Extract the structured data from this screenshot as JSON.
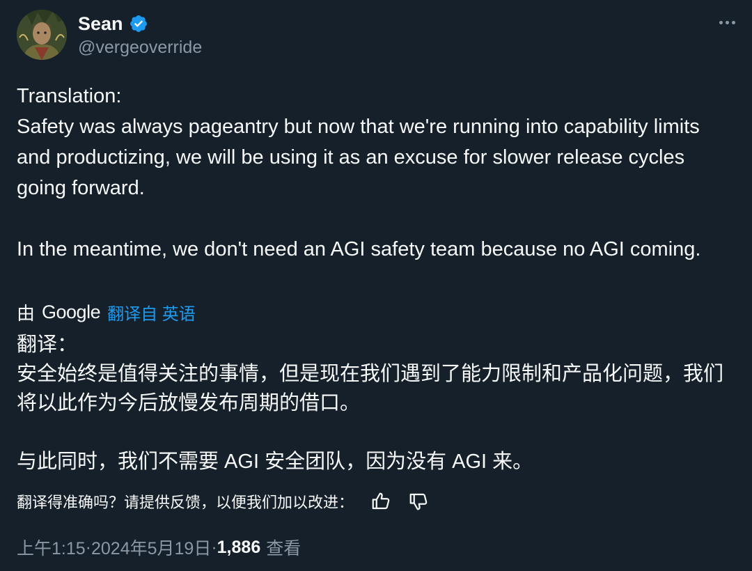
{
  "author": {
    "display_name": "Sean",
    "handle": "@vergeoverride",
    "avatar_icon": "avatar-image",
    "verified_icon": "verified-badge-icon",
    "verified_color": "#1d9bf0"
  },
  "tweet": {
    "original_lines": [
      "Translation:",
      "Safety was always pageantry but now that we're running into capability limits and productizing, we will be using it as an excuse for slower release cycles going forward.",
      "In the meantime, we don't need an AGI safety team because no AGI coming."
    ],
    "translate_by": "由",
    "translate_provider": "Google",
    "translate_link": "翻译自 英语",
    "translated_lines": [
      "翻译：",
      "安全始终是值得关注的事情，但是现在我们遇到了能力限制和产品化问题，我们将以此作为今后放慢发布周期的借口。",
      "与此同时，我们不需要 AGI 安全团队，因为没有 AGI 来。"
    ],
    "feedback_prompt": "翻译得准确吗？请提供反馈，以便我们加以改进：",
    "feedback_icons": [
      "thumbs-up-icon",
      "thumbs-down-icon"
    ]
  },
  "meta": {
    "time": "上午1:15",
    "separator": " · ",
    "date": "2024年5月19日",
    "views_count": "1,886",
    "views_label": "查看"
  },
  "colors": {
    "background": "#15202b",
    "text": "#f7f9f9",
    "secondary": "#8b98a5",
    "accent": "#1d9bf0"
  }
}
